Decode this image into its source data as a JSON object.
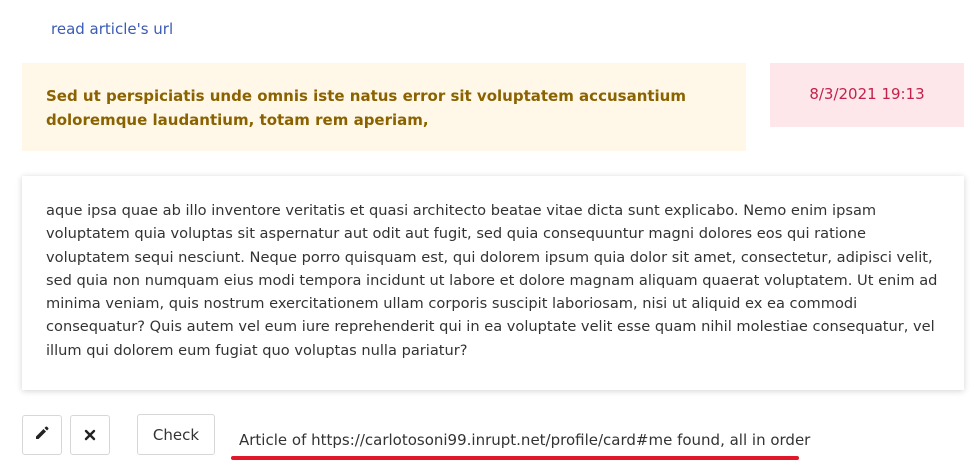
{
  "article": {
    "link_label": "read article's url",
    "title": "Sed ut perspiciatis unde omnis iste natus error sit voluptatem accusantium doloremque laudantium, totam rem aperiam,",
    "date": "8/3/2021 19:13",
    "body": "aque ipsa quae ab illo inventore veritatis et quasi architecto beatae vitae dicta sunt explicabo. Nemo enim ipsam voluptatem quia voluptas sit aspernatur aut odit aut fugit, sed quia consequuntur magni dolores eos qui ratione voluptatem sequi nesciunt. Neque porro quisquam est, qui dolorem ipsum quia dolor sit amet, consectetur, adipisci velit, sed quia non numquam eius modi tempora incidunt ut labore et dolore magnam aliquam quaerat voluptatem. Ut enim ad minima veniam, quis nostrum exercitationem ullam corporis suscipit laboriosam, nisi ut aliquid ex ea commodi consequatur? Quis autem vel eum iure reprehenderit qui in ea voluptate velit esse quam nihil molestiae consequatur, vel illum qui dolorem eum fugiat quo voluptas nulla pariatur?"
  },
  "actions": {
    "edit_icon": "pencil-icon",
    "delete_icon": "close-icon",
    "check_label": "Check"
  },
  "status": {
    "message": "Article of https://carlotosoni99.inrupt.net/profile/card#me found, all in order",
    "underline_color": "#e0182a"
  },
  "colors": {
    "link": "#3b5bb5",
    "title_bg": "#fff8e8",
    "title_text": "#8a6200",
    "date_bg": "#fde7eb",
    "date_text": "#c2224a"
  }
}
